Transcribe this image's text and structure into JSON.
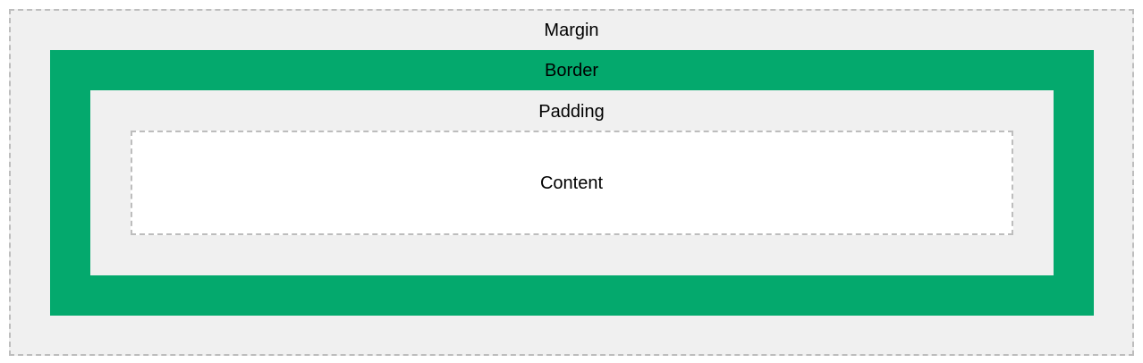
{
  "labels": {
    "margin": "Margin",
    "border": "Border",
    "padding": "Padding",
    "content": "Content"
  },
  "colors": {
    "margin_fill": "#f0f0f0",
    "border_fill": "#04a96d",
    "padding_fill": "#f0f0f0",
    "content_fill": "#ffffff",
    "dashed_outline": "#bdbdbd"
  }
}
